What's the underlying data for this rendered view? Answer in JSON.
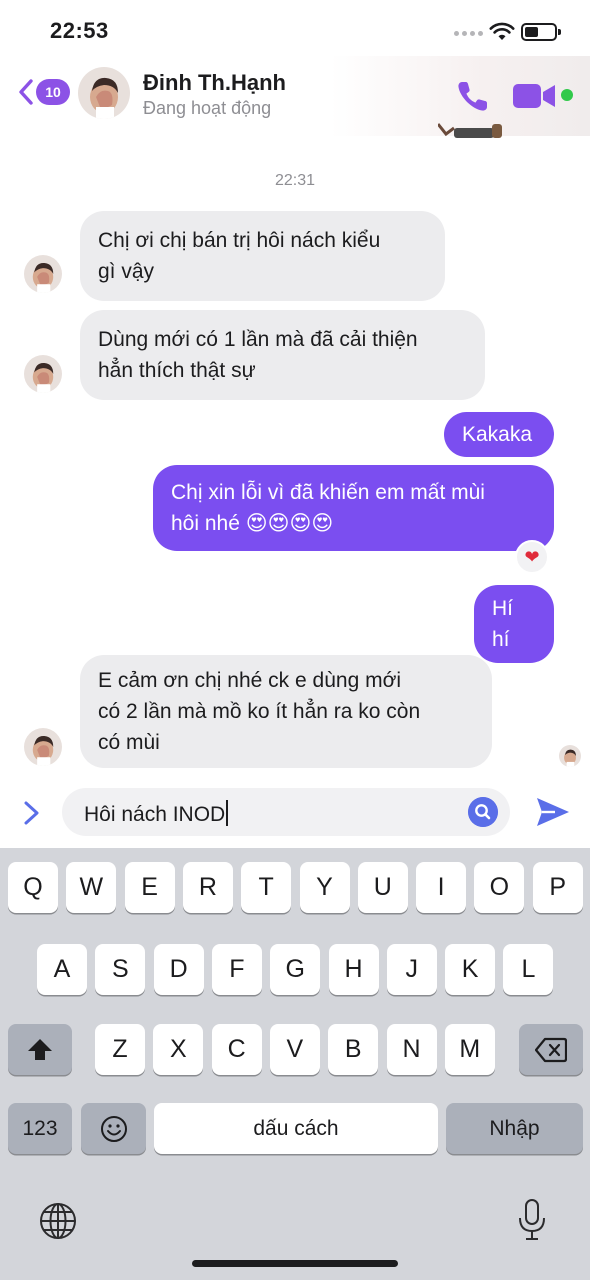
{
  "status_bar": {
    "time": "22:53"
  },
  "header": {
    "back_count": "10",
    "contact_name": "Đinh Th.Hạnh",
    "contact_status": "Đang hoạt động",
    "accent_color": "#8c52e6",
    "icons": [
      "chevron-left-icon",
      "phone-icon",
      "video-camera-icon"
    ]
  },
  "conversation": {
    "timestamp": "22:31",
    "messages": [
      {
        "direction": "incoming",
        "lines": [
          "Chị ơi chị bán trị hôi nách kiểu",
          "gì vậy"
        ]
      },
      {
        "direction": "incoming",
        "lines": [
          "Dùng mới có 1 lần mà đã cải thiện",
          "hẳn thích thật sự"
        ]
      },
      {
        "direction": "outgoing",
        "lines": [
          "Kakaka"
        ]
      },
      {
        "direction": "outgoing",
        "lines": [
          "Chị xin lỗi vì đã khiến em mất mùi",
          "hôi nhé 😍😍😍😍"
        ],
        "reaction": "❤"
      },
      {
        "direction": "outgoing",
        "lines": [
          "Hí hí"
        ]
      },
      {
        "direction": "incoming",
        "lines": [
          "E cảm ơn chị nhé ck e dùng mới",
          "có 2 lần mà mồ ko ít hẳn ra ko còn",
          "có mùi"
        ]
      }
    ]
  },
  "composer": {
    "text": "Hôi nách INOD"
  },
  "keyboard": {
    "row1": [
      "Q",
      "W",
      "E",
      "R",
      "T",
      "Y",
      "U",
      "I",
      "O",
      "P"
    ],
    "row2": [
      "A",
      "S",
      "D",
      "F",
      "G",
      "H",
      "J",
      "K",
      "L"
    ],
    "row3": [
      "Z",
      "X",
      "C",
      "V",
      "B",
      "N",
      "M"
    ],
    "numbers_key": "123",
    "space_key": "dấu cách",
    "return_key": "Nhập"
  },
  "colors": {
    "outgoing_bubble": "#7b4ef0",
    "incoming_bubble": "#ececee",
    "keyboard_bg": "#d3d5da"
  }
}
